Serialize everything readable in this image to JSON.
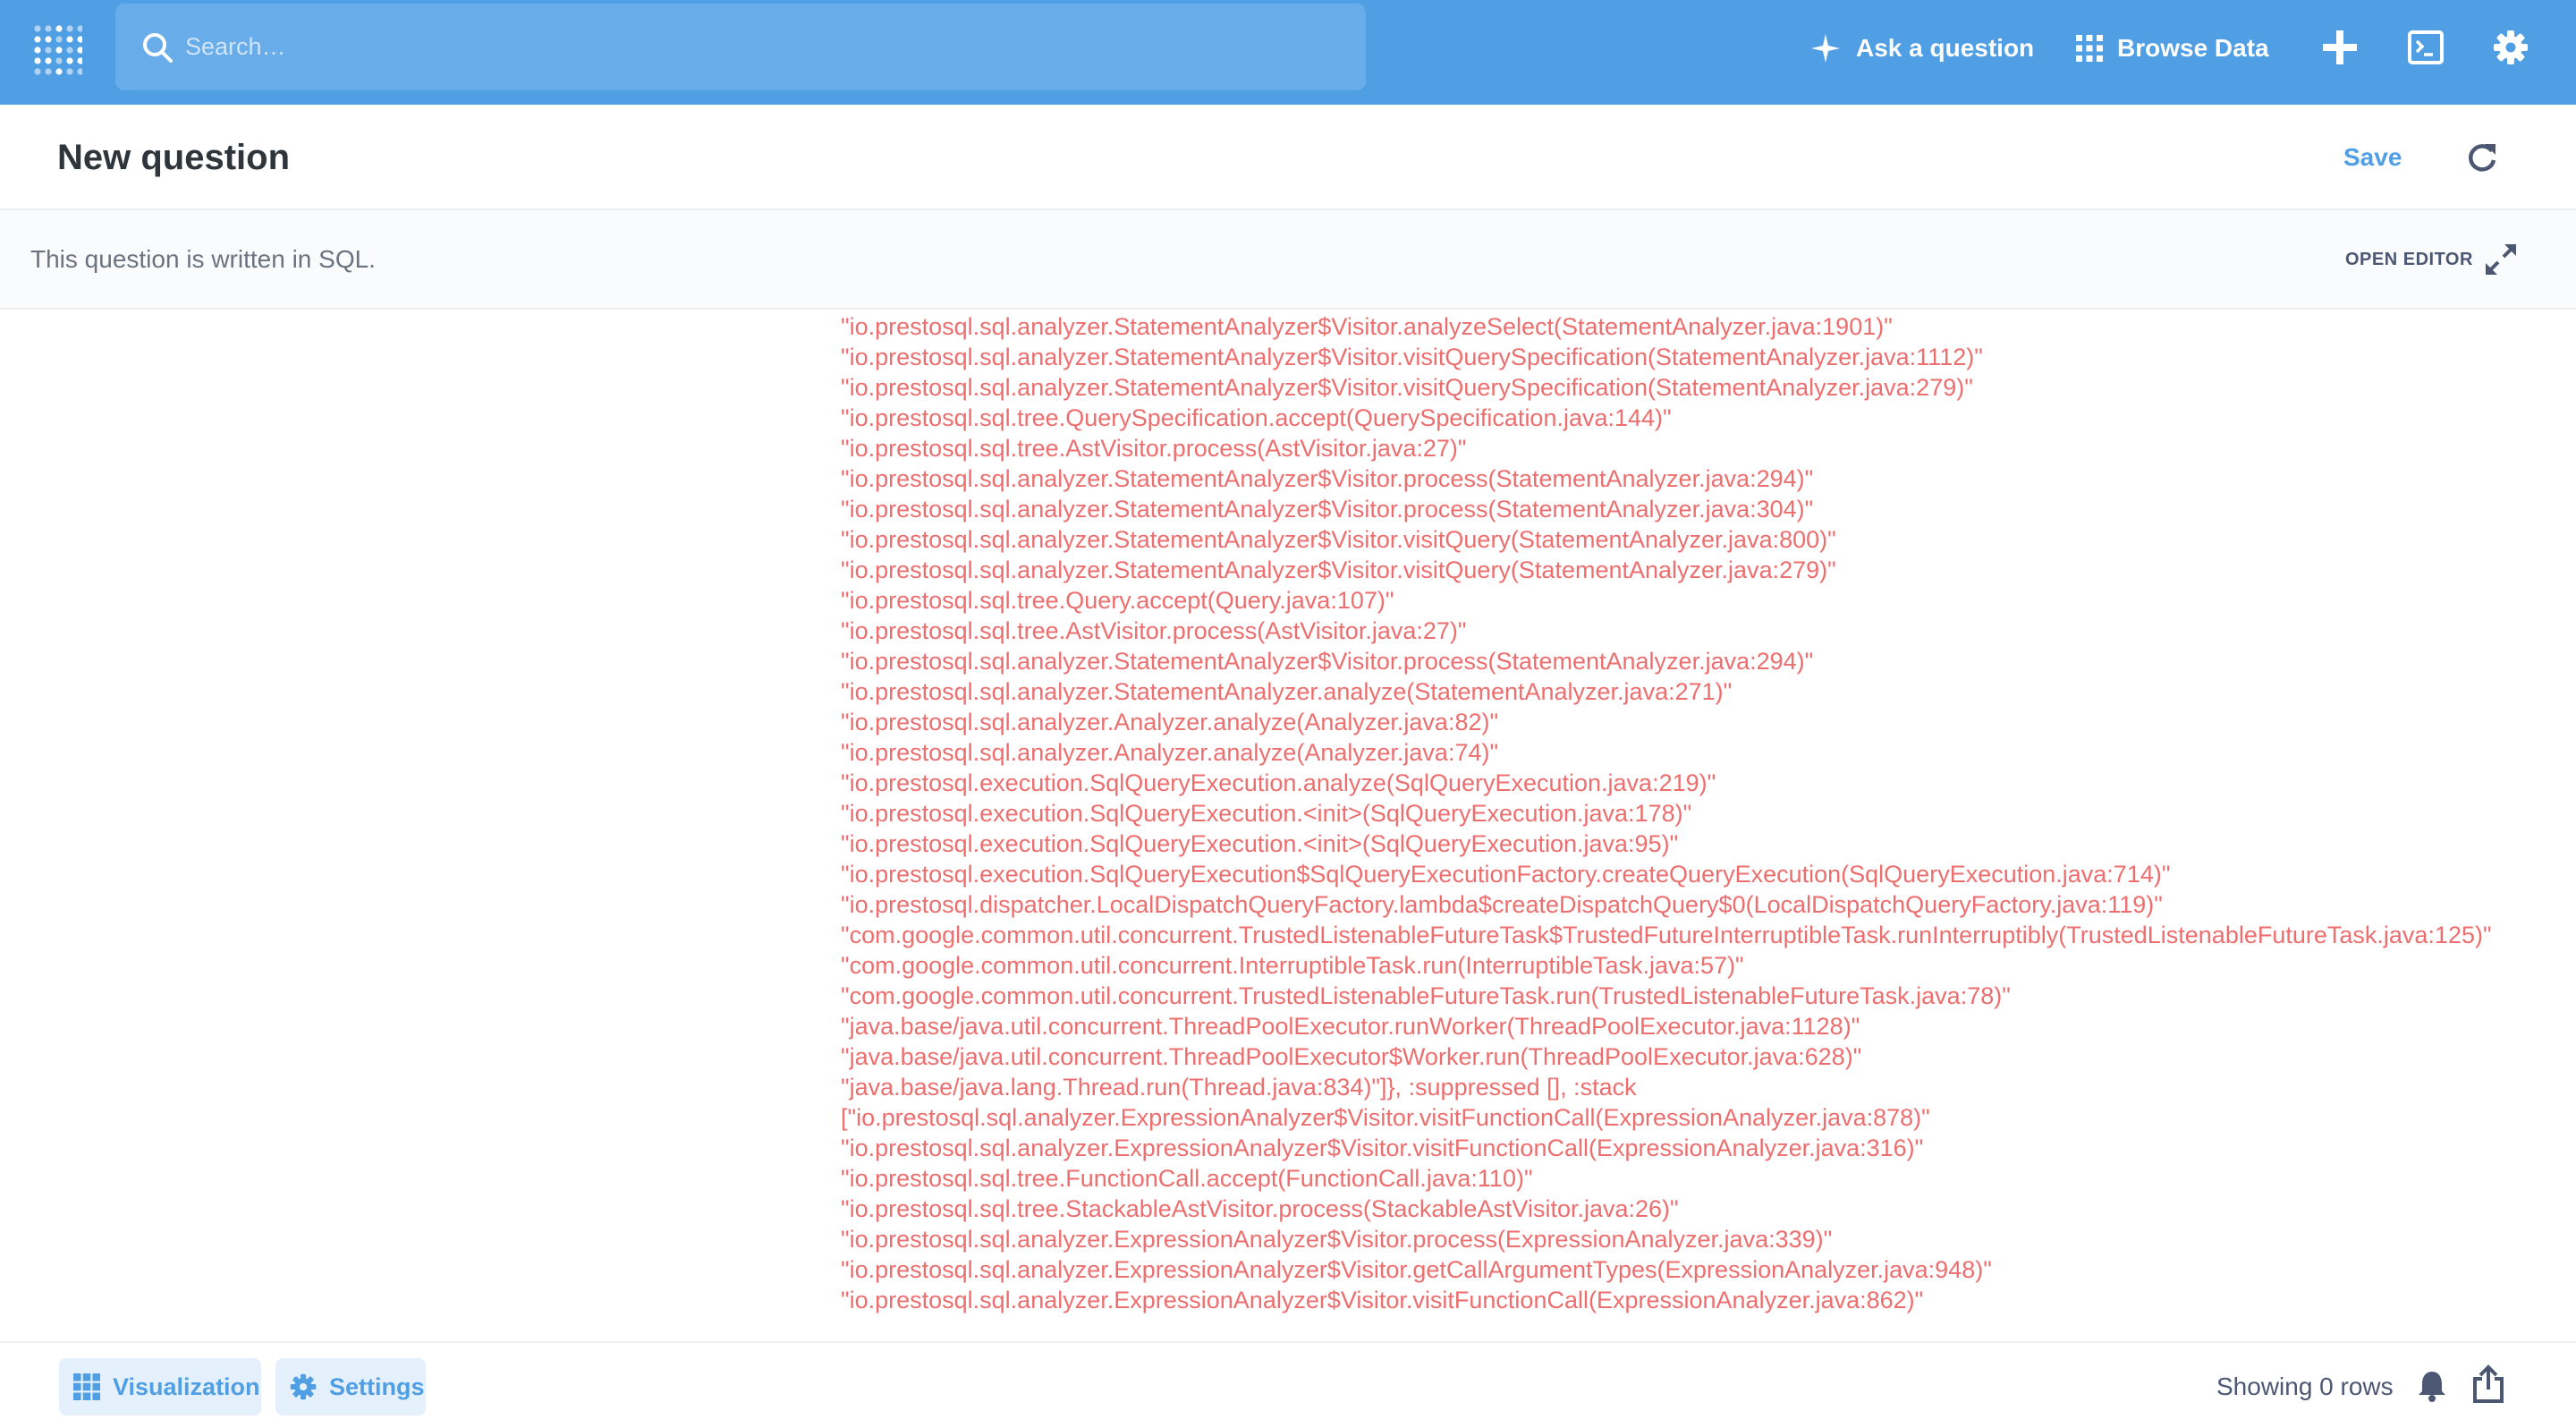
{
  "nav": {
    "search_placeholder": "Search…",
    "ask_label": "Ask a question",
    "browse_label": "Browse Data"
  },
  "header": {
    "title": "New question",
    "save_label": "Save"
  },
  "sqlbar": {
    "note": "This question is written in SQL.",
    "open_editor_label": "OPEN EDITOR"
  },
  "error": {
    "lines": [
      "\"io.prestosql.sql.analyzer.StatementAnalyzer$Visitor.analyzeSelect(StatementAnalyzer.java:1901)\"",
      "\"io.prestosql.sql.analyzer.StatementAnalyzer$Visitor.visitQuerySpecification(StatementAnalyzer.java:1112)\"",
      "\"io.prestosql.sql.analyzer.StatementAnalyzer$Visitor.visitQuerySpecification(StatementAnalyzer.java:279)\"",
      "\"io.prestosql.sql.tree.QuerySpecification.accept(QuerySpecification.java:144)\"",
      "\"io.prestosql.sql.tree.AstVisitor.process(AstVisitor.java:27)\"",
      "\"io.prestosql.sql.analyzer.StatementAnalyzer$Visitor.process(StatementAnalyzer.java:294)\"",
      "\"io.prestosql.sql.analyzer.StatementAnalyzer$Visitor.process(StatementAnalyzer.java:304)\"",
      "\"io.prestosql.sql.analyzer.StatementAnalyzer$Visitor.visitQuery(StatementAnalyzer.java:800)\"",
      "\"io.prestosql.sql.analyzer.StatementAnalyzer$Visitor.visitQuery(StatementAnalyzer.java:279)\"",
      "\"io.prestosql.sql.tree.Query.accept(Query.java:107)\"",
      "\"io.prestosql.sql.tree.AstVisitor.process(AstVisitor.java:27)\"",
      "\"io.prestosql.sql.analyzer.StatementAnalyzer$Visitor.process(StatementAnalyzer.java:294)\"",
      "\"io.prestosql.sql.analyzer.StatementAnalyzer.analyze(StatementAnalyzer.java:271)\"",
      "\"io.prestosql.sql.analyzer.Analyzer.analyze(Analyzer.java:82)\"",
      "\"io.prestosql.sql.analyzer.Analyzer.analyze(Analyzer.java:74)\"",
      "\"io.prestosql.execution.SqlQueryExecution.analyze(SqlQueryExecution.java:219)\"",
      "\"io.prestosql.execution.SqlQueryExecution.<init>(SqlQueryExecution.java:178)\"",
      "\"io.prestosql.execution.SqlQueryExecution.<init>(SqlQueryExecution.java:95)\"",
      "\"io.prestosql.execution.SqlQueryExecution$SqlQueryExecutionFactory.createQueryExecution(SqlQueryExecution.java:714)\"",
      "\"io.prestosql.dispatcher.LocalDispatchQueryFactory.lambda$createDispatchQuery$0(LocalDispatchQueryFactory.java:119)\"",
      "\"com.google.common.util.concurrent.TrustedListenableFutureTask$TrustedFutureInterruptibleTask.runInterruptibly(TrustedListenableFutureTask.java:125)\"",
      "\"com.google.common.util.concurrent.InterruptibleTask.run(InterruptibleTask.java:57)\"",
      "\"com.google.common.util.concurrent.TrustedListenableFutureTask.run(TrustedListenableFutureTask.java:78)\"",
      "\"java.base/java.util.concurrent.ThreadPoolExecutor.runWorker(ThreadPoolExecutor.java:1128)\"",
      "\"java.base/java.util.concurrent.ThreadPoolExecutor$Worker.run(ThreadPoolExecutor.java:628)\"",
      "\"java.base/java.lang.Thread.run(Thread.java:834)\"]}, :suppressed [], :stack",
      "[\"io.prestosql.sql.analyzer.ExpressionAnalyzer$Visitor.visitFunctionCall(ExpressionAnalyzer.java:878)\"",
      "\"io.prestosql.sql.analyzer.ExpressionAnalyzer$Visitor.visitFunctionCall(ExpressionAnalyzer.java:316)\"",
      "\"io.prestosql.sql.tree.FunctionCall.accept(FunctionCall.java:110)\"",
      "\"io.prestosql.sql.tree.StackableAstVisitor.process(StackableAstVisitor.java:26)\"",
      "\"io.prestosql.sql.analyzer.ExpressionAnalyzer$Visitor.process(ExpressionAnalyzer.java:339)\"",
      "\"io.prestosql.sql.analyzer.ExpressionAnalyzer$Visitor.getCallArgumentTypes(ExpressionAnalyzer.java:948)\"",
      "\"io.prestosql.sql.analyzer.ExpressionAnalyzer$Visitor.visitFunctionCall(ExpressionAnalyzer.java:862)\""
    ]
  },
  "footer": {
    "visualization_label": "Visualization",
    "settings_label": "Settings",
    "rows_text": "Showing 0 rows"
  },
  "colors": {
    "brand": "#509ee3",
    "error_text": "#ed6e6e",
    "title_text": "#2e353b"
  },
  "icons": {
    "logo": "metabase-logo",
    "search": "search-icon",
    "ask": "sparkle-icon",
    "browse": "grid-icon",
    "new": "plus-icon",
    "sql": "console-icon",
    "settings": "gear-icon",
    "refresh": "refresh-icon",
    "expand": "expand-icon",
    "visualization": "table-grid-icon",
    "footer_settings": "gear-icon",
    "alert": "bell-icon",
    "share": "share-icon"
  }
}
